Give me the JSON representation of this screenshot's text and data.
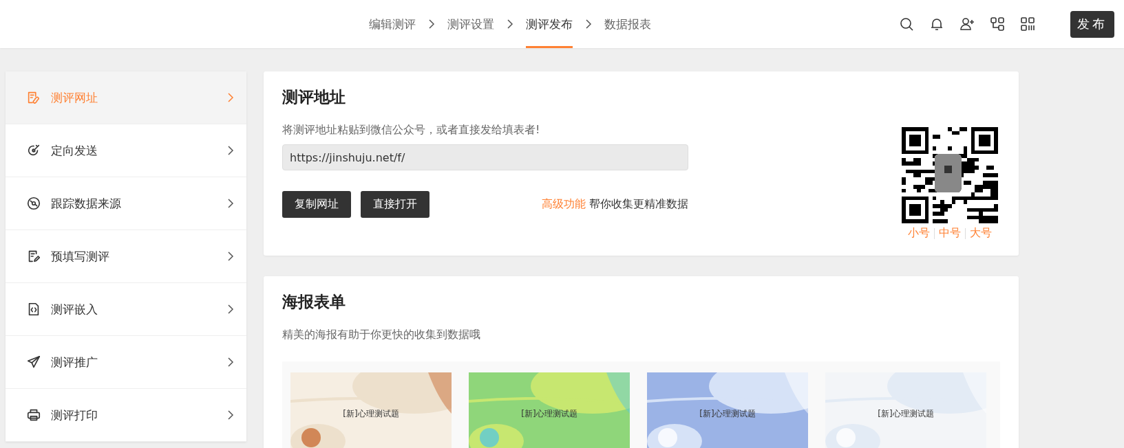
{
  "steps": [
    {
      "label": "编辑测评",
      "selected": false
    },
    {
      "label": "测评设置",
      "selected": false
    },
    {
      "label": "测评发布",
      "selected": true
    },
    {
      "label": "数据报表",
      "selected": false
    }
  ],
  "toolbar": {
    "publish_button": "发布"
  },
  "sidebar": {
    "items": [
      {
        "label": "测评网址",
        "selected": true
      },
      {
        "label": "定向发送",
        "selected": false
      },
      {
        "label": "跟踪数据来源",
        "selected": false
      },
      {
        "label": "预填写测评",
        "selected": false
      },
      {
        "label": "测评嵌入",
        "selected": false
      },
      {
        "label": "测评推广",
        "selected": false
      },
      {
        "label": "测评打印",
        "selected": false
      }
    ]
  },
  "address_card": {
    "title": "测评地址",
    "hint": "将测评地址粘贴到微信公众号，或者直接发给填表者!",
    "url": "https://jinshuju.net/f/",
    "buttons": [
      "复制网址",
      "直接打开"
    ],
    "promo_link": "高级功能",
    "promo_text": "帮你收集更精准数据",
    "qr_sizes": [
      "小号",
      "中号",
      "大号"
    ]
  },
  "poster_card": {
    "title": "海报表单",
    "hint": "精美的海报有助于你更快的收集到数据哦",
    "posters": [
      {
        "label": "[新]心理测试题",
        "kind": "picture"
      },
      {
        "label": "[新]心理测试题",
        "kind": "picture"
      },
      {
        "label": "[新]心理测试题",
        "kind": "picture"
      },
      {
        "label": "[新]心理测试题",
        "kind": "picture"
      }
    ]
  }
}
